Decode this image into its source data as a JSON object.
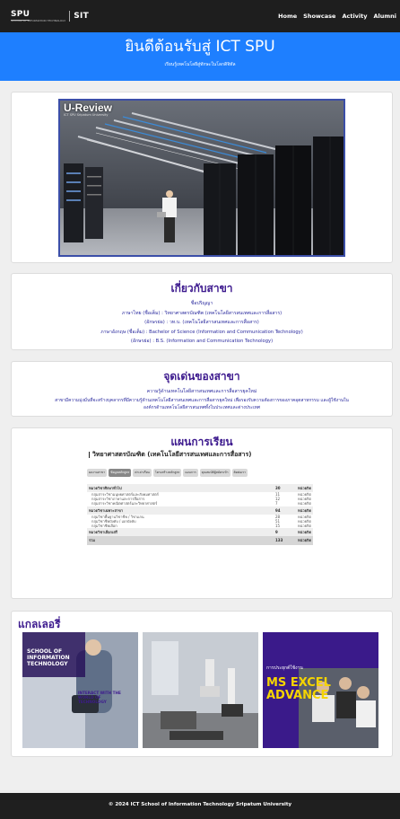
{
  "header": {
    "logo_text": "SPU",
    "logo_text2": "SIT",
    "logo_sub": "SCHOOL OF INFORMATION TECHNOLOGY",
    "nav": [
      "Home",
      "Showcase",
      "Activity",
      "Alumni"
    ]
  },
  "hero": {
    "title": "ยินดีต้อนรับสู่ ICT SPU",
    "subtitle": "เรียนรู้เทคโนโลยีสู่ทักษะในโลกดิจิทัล"
  },
  "video": {
    "title": "U-Review",
    "subtitle": "ICT SPU Sripatum University"
  },
  "about": {
    "heading": "เกี่ยวกับสาขา",
    "lines": [
      "ชื่อปริญญา",
      "ภาษาไทย (ชื่อเต็ม) : วิทยาศาสตรบัณฑิต (เทคโนโลยีสารสนเทศและการสื่อสาร)",
      "(อักษรย่อ) : วท.บ. (เทคโนโลยีสารสนเทศและการสื่อสาร)",
      "ภาษาอังกฤษ (ชื่อเต็ม) : Bachelor of Science (Information and Communication Technology)",
      "(อักษรย่อ) : B.S. (Information and Communication Technology)"
    ]
  },
  "highlights": {
    "heading": "จุดเด่นของสาขา",
    "lines": [
      "ความรู้ด้านเทคโนโลยีสารสนเทศและการสื่อสารยุคใหม่",
      "สาขามีความมุ่งมั่นที่จะสร้างบุคลากรที่มีความรู้ด้านเทคโนโลยีสารสนเทศและการสื่อสารยุคใหม่ เพื่อรองรับความต้องการของภาคอุตสาหกรรม และผู้ใช้งานใน",
      "องค์กรด้านเทคโนโลยีสารสนเทศทั้งในประเทศและต่างประเทศ"
    ]
  },
  "curriculum": {
    "heading": "แผนการเรียน",
    "title": "วิทยาศาสตรบัณฑิต (เทคโนโลยีสารสนเทศและการสื่อสาร)",
    "tabs": [
      "ผลงานสาขา",
      "ข้อมูลหลักสูตร",
      "ค่าเล่าเรียน",
      "โครงสร้างหลักสูตร",
      "แผนการ",
      "คุณสมบัติผู้สมัครเข้า",
      "ติดต่อเรา"
    ],
    "active_tab": 1,
    "rows": [
      {
        "type": "head",
        "label": "หมวดวิชาศึกษาทั่วไป",
        "credits": "30",
        "unit": "หน่วยกิต"
      },
      {
        "type": "row",
        "label": "กลุ่มสาระวิชามนุษยศาสตร์และสังคมศาสตร์",
        "credits": "11",
        "unit": "หน่วยกิต"
      },
      {
        "type": "row",
        "label": "กลุ่มสาระวิชาภาษาและการสื่อสาร",
        "credits": "12",
        "unit": "หน่วยกิต"
      },
      {
        "type": "row",
        "label": "กลุ่มสาระวิชาคณิตศาสตร์และวิทยาศาสตร์",
        "credits": "7",
        "unit": "หน่วยกิต"
      },
      {
        "type": "head",
        "label": "หมวดวิชาเฉพาะสาขา",
        "credits": "94",
        "unit": "หน่วยกิต"
      },
      {
        "type": "row",
        "label": "กลุ่มวิชาพื้นฐานวิชาชีพ / วิชาแกน",
        "credits": "28",
        "unit": "หน่วยกิต"
      },
      {
        "type": "row",
        "label": "กลุ่มวิชาชีพบังคับ / เอกบังคับ",
        "credits": "51",
        "unit": "หน่วยกิต"
      },
      {
        "type": "row",
        "label": "กลุ่มวิชาชีพเลือก",
        "credits": "15",
        "unit": "หน่วยกิต"
      },
      {
        "type": "head",
        "label": "หมวดวิชาเลือกเสรี",
        "credits": "9",
        "unit": "หน่วยกิต"
      },
      {
        "type": "total",
        "label": "รวม",
        "credits": "133",
        "unit": "หน่วยกิต"
      }
    ]
  },
  "gallery": {
    "heading": "แกลเลอรี่",
    "item1_lines": [
      "SCHOOL OF",
      "INFORMATION",
      "TECHNOLOGY"
    ],
    "item1_tag": "INTERACT WITH THE WORLD OF TECHNOLOGY",
    "item3_top": "การประยุกต์ใช้งาน",
    "item3_big1": "MS EXCEL",
    "item3_big2": "ADVANCE"
  },
  "footer": {
    "text": "© 2024 ICT School of Information Technology Sripatum University"
  },
  "colors": {
    "hero_bg": "#1e7fff",
    "heading": "#3d1a8e",
    "topbar": "#1e1e1e"
  }
}
